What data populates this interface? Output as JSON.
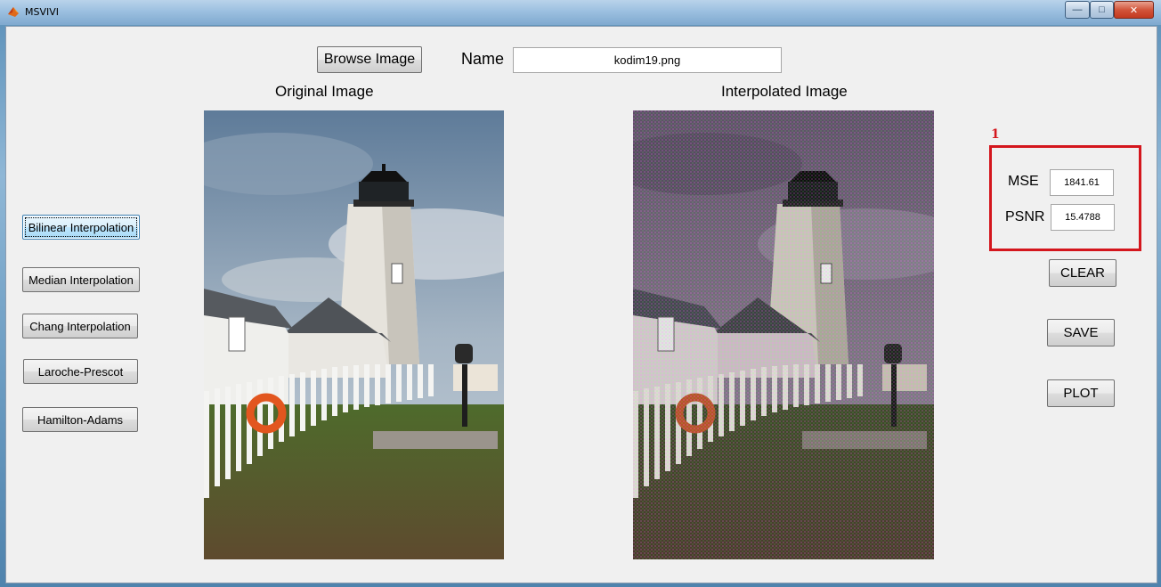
{
  "window": {
    "title": "MSVIVI",
    "minimize_glyph": "—",
    "maximize_glyph": "□",
    "close_glyph": "✕"
  },
  "header": {
    "browse_label": "Browse Image",
    "name_label": "Name",
    "name_value": "kodim19.png"
  },
  "panels": {
    "original_title": "Original Image",
    "interpolated_title": "Interpolated Image"
  },
  "methods": [
    "Bilinear Interpolation",
    "Median Interpolation",
    "Chang Interpolation",
    "Laroche-Prescot",
    "Hamilton-Adams"
  ],
  "metrics": {
    "annotation": "1",
    "mse_label": "MSE",
    "mse_value": "1841.61",
    "psnr_label": "PSNR",
    "psnr_value": "15.4788"
  },
  "actions": {
    "clear_label": "CLEAR",
    "save_label": "SAVE",
    "plot_label": "PLOT"
  },
  "colors": {
    "annotation_red": "#d4161d",
    "window_bg": "#f0f0f0"
  }
}
